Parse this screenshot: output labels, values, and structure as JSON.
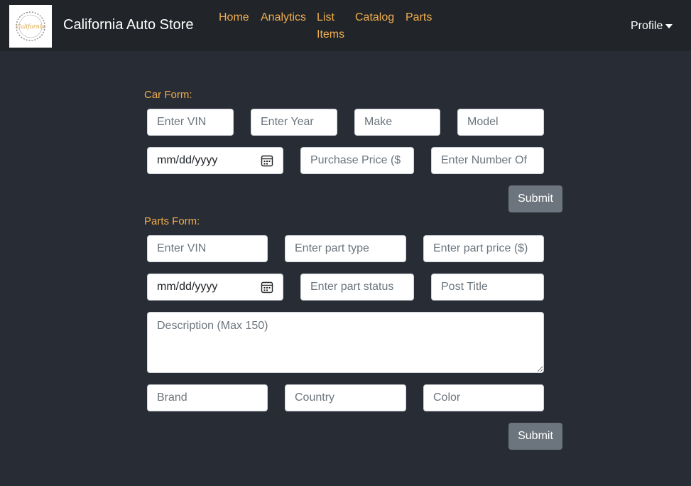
{
  "navbar": {
    "brand": "California Auto Store",
    "logo_icon": "california-auto-store-logo",
    "links": [
      "Home",
      "Analytics",
      "List Items",
      "Catalog",
      "Parts"
    ],
    "profile_label": "Profile"
  },
  "car_form": {
    "label": "Car Form:",
    "vin_placeholder": "Enter VIN",
    "year_placeholder": "Enter Year",
    "make_placeholder": "Make",
    "model_placeholder": "Model",
    "date_placeholder": "mm/dd/yyyy",
    "price_placeholder": "Purchase Price ($",
    "number_placeholder": "Enter Number Of",
    "submit_label": "Submit"
  },
  "parts_form": {
    "label": "Parts Form:",
    "vin_placeholder": "Enter VIN",
    "type_placeholder": "Enter part type",
    "price_placeholder": "Enter part price ($)",
    "date_placeholder": "mm/dd/yyyy",
    "status_placeholder": "Enter part status",
    "title_placeholder": "Post Title",
    "description_placeholder": "Description (Max 150)",
    "brand_placeholder": "Brand",
    "country_placeholder": "Country",
    "color_placeholder": "Color",
    "submit_label": "Submit"
  },
  "colors": {
    "background": "#282c34",
    "navbar": "#212529",
    "accent": "#f0ad4e",
    "button": "#6c757d"
  }
}
